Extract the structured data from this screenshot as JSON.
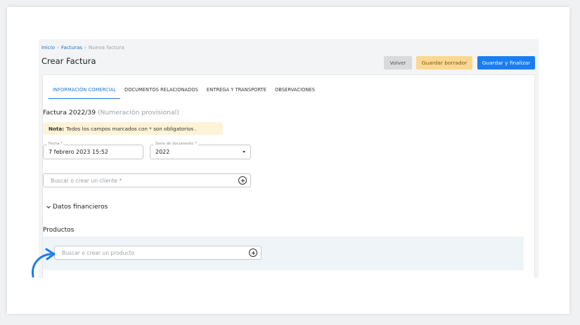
{
  "breadcrumb": {
    "home": "Inicio",
    "sep": "›",
    "invoices": "Facturas",
    "current": "Nueva factura"
  },
  "header": {
    "title": "Crear Factura",
    "btn_back": "Volver",
    "btn_draft": "Guardar borrador",
    "btn_finalize": "Guardar y finalizar"
  },
  "tabs": [
    {
      "label": "INFORMACIÓN COMERCIAL",
      "active": true
    },
    {
      "label": "DOCUMENTOS RELACIONADOS",
      "active": false
    },
    {
      "label": "ENTREGA Y TRANSPORTE",
      "active": false
    },
    {
      "label": "OBSERVACIONES",
      "active": false
    }
  ],
  "invoice": {
    "number": "Factura 2022/39",
    "provisional": "(Numeración provisional)"
  },
  "note": {
    "label": "Nota:",
    "text": "Todos los campos marcados con * son obligatorios ."
  },
  "fields": {
    "fecha_label": "Fecha *",
    "fecha_value": "7 febrero 2023 15:52",
    "serie_label": "Serie de documento *",
    "serie_value": "2022"
  },
  "client_search": {
    "placeholder": "Buscar o crear un cliente *"
  },
  "financial": {
    "label": "Datos financieros"
  },
  "products": {
    "label": "Productos",
    "placeholder": "Buscar o crear un producto"
  },
  "colors": {
    "primary": "#1a7df0",
    "draft": "#fad891",
    "note_bg": "#fdf3d7",
    "annotation": "#1a7df0"
  }
}
